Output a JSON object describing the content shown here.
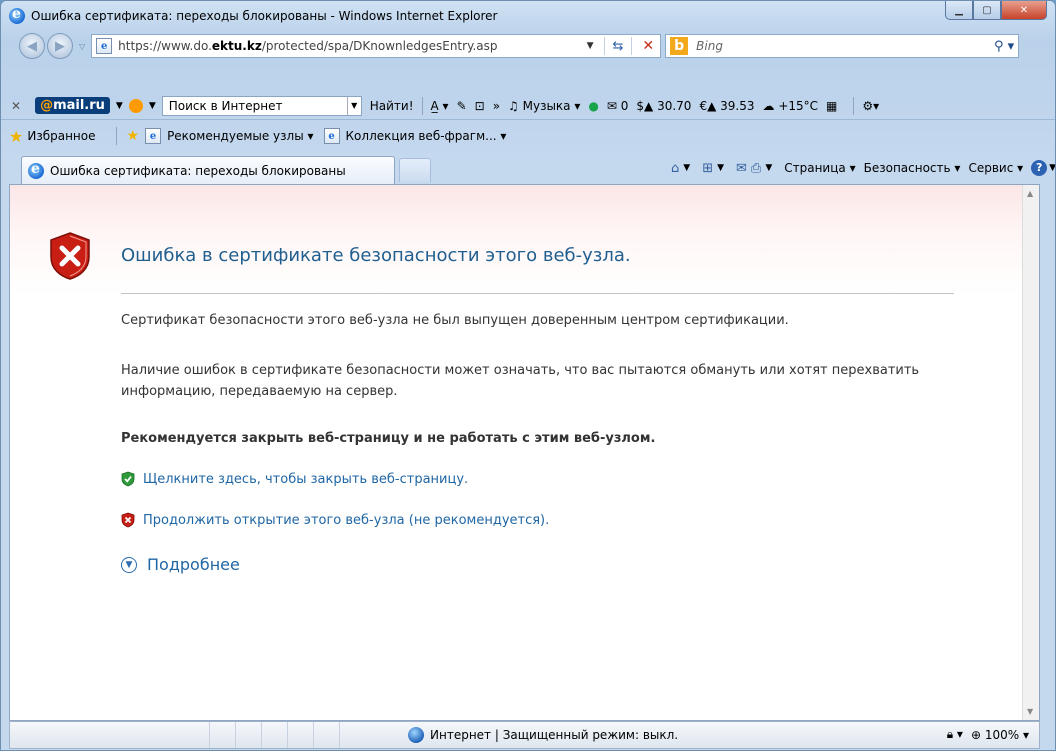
{
  "window": {
    "title": "Ошибка сертификата: переходы блокированы - Windows Internet Explorer",
    "minimize_icon": "minimize-icon",
    "maximize_icon": "maximize-icon",
    "close_icon": "close-icon"
  },
  "address_bar": {
    "url_prefix": "https://www.do.",
    "url_domain": "ektu.kz",
    "url_suffix": "/protected/spa/DKnownledgesEntry.asp"
  },
  "search": {
    "placeholder": "Bing"
  },
  "mail_toolbar": {
    "logo": "mail.ru",
    "search_placeholder": "Поиск в Интернет",
    "find_button": "Найти!",
    "music": "Музыка",
    "mail_count": "0",
    "usd": "30.70",
    "eur": "39.53",
    "weather": "+15°C"
  },
  "favorites_bar": {
    "favorites": "Избранное",
    "suggested_sites": "Рекомендуемые узлы",
    "web_slices": "Коллекция веб-фрагм..."
  },
  "tab": {
    "title": "Ошибка сертификата: переходы блокированы"
  },
  "command_bar": {
    "page": "Страница",
    "safety": "Безопасность",
    "tools": "Сервис"
  },
  "content": {
    "heading": "Ошибка в сертификате безопасности этого веб-узла.",
    "p1": "Сертификат безопасности этого веб-узла не был выпущен доверенным центром сертификации.",
    "p2": "Наличие ошибок в сертификате безопасности может означать, что вас пытаются обмануть или хотят перехватить информацию, передаваемую на сервер.",
    "recommendation": "Рекомендуется закрыть веб-страницу и не работать с этим веб-узлом.",
    "close_link": "Щелкните здесь, чтобы закрыть веб-страницу.",
    "continue_link": "Продолжить открытие этого веб-узла (не рекомендуется).",
    "more_info": "Подробнее"
  },
  "status_bar": {
    "zone": "Интернет | Защищенный режим: выкл.",
    "zoom": "100%"
  },
  "colors": {
    "link": "#1f66a5",
    "heading": "#1f5e8f",
    "error_red": "#c62b1a"
  }
}
